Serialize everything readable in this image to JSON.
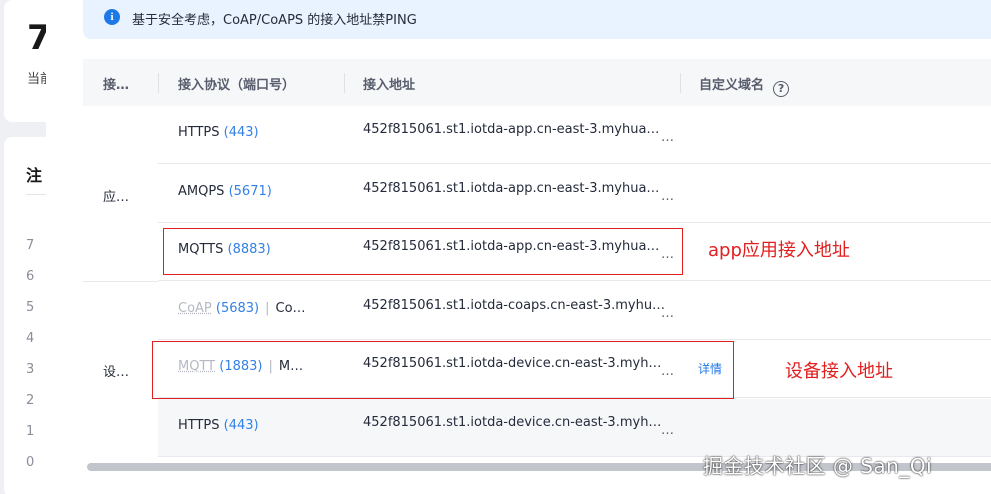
{
  "background": {
    "big_number": "7",
    "sub_text": "当前",
    "section_title": "注",
    "axis": [
      "7",
      "6",
      "5",
      "4",
      "3",
      "2",
      "1",
      "0"
    ]
  },
  "notice": {
    "icon": "info-icon",
    "icon_glyph": "i",
    "text": "基于安全考虑，CoAP/CoAPS 的接入地址禁PING"
  },
  "table": {
    "headers": {
      "type": "接…",
      "protocol": "接入协议（端口号）",
      "address": "接入地址",
      "domain": "自定义域名",
      "help_glyph": "?"
    },
    "groups": {
      "app": "应…",
      "device": "设…"
    },
    "rows": [
      {
        "protocol": "HTTPS",
        "port": "(443)",
        "address": "452f815061.st1.iotda-app.cn-east-3.myhua…",
        "more": "…"
      },
      {
        "protocol": "AMQPS",
        "port": "(5671)",
        "address": "452f815061.st1.iotda-app.cn-east-3.myhua…",
        "more": "…"
      },
      {
        "protocol": "MQTTS",
        "port": "(8883)",
        "address": "452f815061.st1.iotda-app.cn-east-3.myhua…",
        "more": "…"
      },
      {
        "protocol": "CoAP",
        "port": "(5683)",
        "sep": "|",
        "alt": "Co…",
        "address": "452f815061.st1.iotda-coaps.cn-east-3.myhu…",
        "more": "…"
      },
      {
        "protocol": "MQTT",
        "port": "(1883)",
        "sep": "|",
        "alt": "M…",
        "address": "452f815061.st1.iotda-device.cn-east-3.myh…",
        "more": "…",
        "detail": "详情"
      },
      {
        "protocol": "HTTPS",
        "port": "(443)",
        "address": "452f815061.st1.iotda-device.cn-east-3.myh…",
        "more": "…"
      }
    ]
  },
  "annotations": {
    "app_label": "app应用接入地址",
    "device_label": "设备接入地址"
  },
  "watermark": "掘金技术社区 @ San_Qi",
  "colors": {
    "link": "#3480e6",
    "annotation": "#e02020",
    "notice_bg": "#e9f2ff"
  }
}
